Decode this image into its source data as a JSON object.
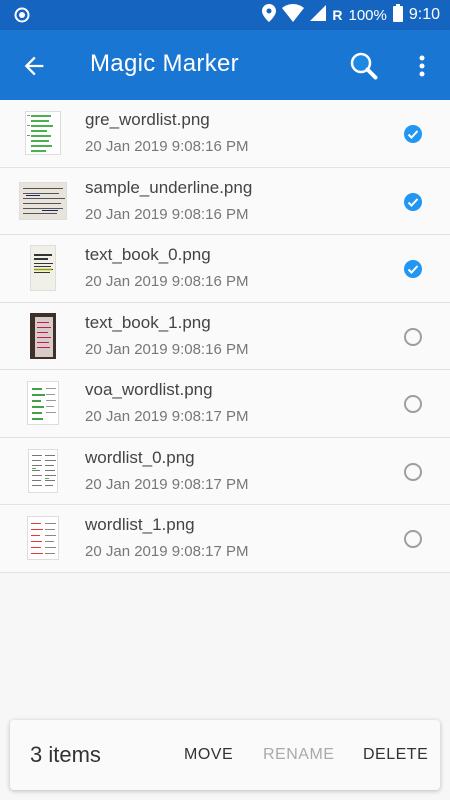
{
  "status_bar": {
    "battery": "100%",
    "time": "9:10",
    "network_letter": "R"
  },
  "app_bar": {
    "title": "Magic Marker",
    "icons": [
      "back-arrow-icon",
      "search-icon",
      "more-vertical-icon"
    ]
  },
  "files": [
    {
      "name": "gre_wordlist.png",
      "date": "20 Jan 2019 9:08:16 PM",
      "selected": true
    },
    {
      "name": "sample_underline.png",
      "date": "20 Jan 2019 9:08:16 PM",
      "selected": true
    },
    {
      "name": "text_book_0.png",
      "date": "20 Jan 2019 9:08:16 PM",
      "selected": true
    },
    {
      "name": "text_book_1.png",
      "date": "20 Jan 2019 9:08:16 PM",
      "selected": false
    },
    {
      "name": "voa_wordlist.png",
      "date": "20 Jan 2019 9:08:17 PM",
      "selected": false
    },
    {
      "name": "wordlist_0.png",
      "date": "20 Jan 2019 9:08:17 PM",
      "selected": false
    },
    {
      "name": "wordlist_1.png",
      "date": "20 Jan 2019 9:08:17 PM",
      "selected": false
    }
  ],
  "bottom_bar": {
    "count_label": "3 items",
    "move_label": "MOVE",
    "rename_label": "RENAME",
    "delete_label": "DELETE"
  },
  "colors": {
    "status_bar": "#1565c0",
    "app_bar": "#1976d2",
    "checked": "#2196f3",
    "unchecked": "#9e9e9e"
  }
}
